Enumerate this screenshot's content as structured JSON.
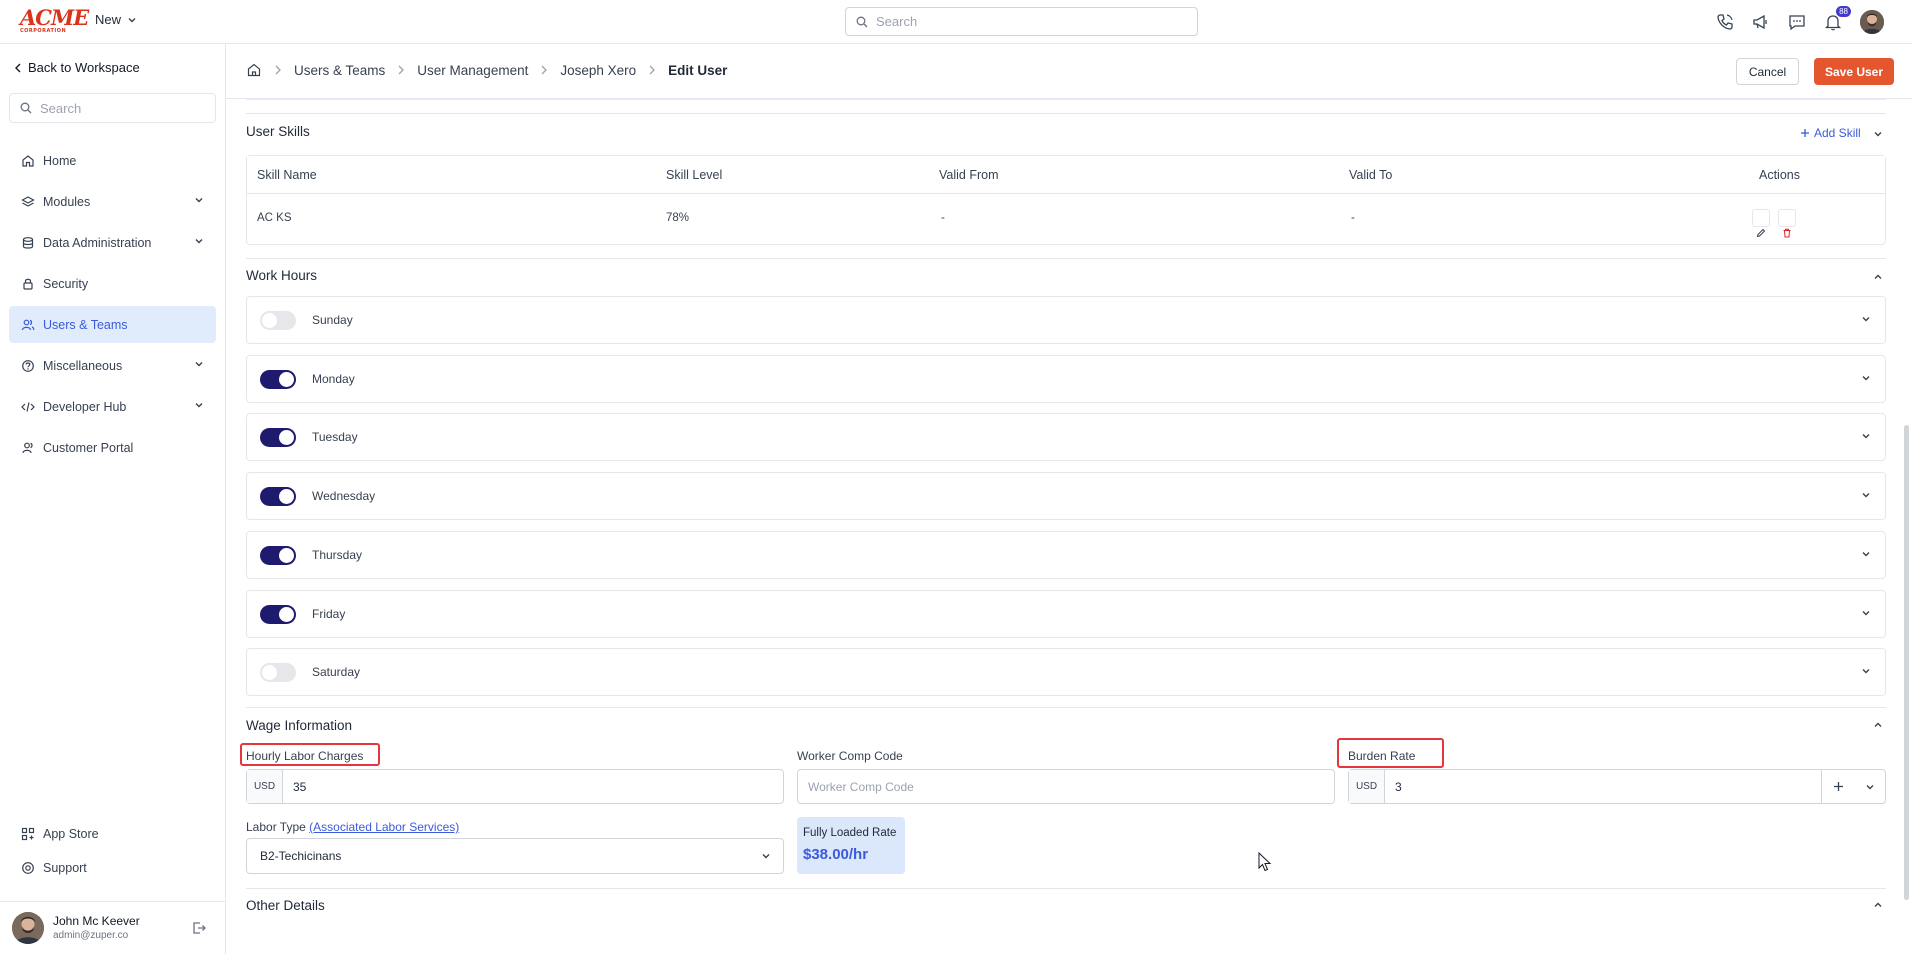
{
  "topbar": {
    "logo_main": "ACME",
    "logo_sub": "CORPORATION",
    "new_label": "New",
    "search_placeholder": "Search",
    "notification_count": "88"
  },
  "sidebar": {
    "back_label": "Back to Workspace",
    "search_placeholder": "Search",
    "items": [
      {
        "label": "Home",
        "icon": "home-icon"
      },
      {
        "label": "Modules",
        "icon": "layers-icon",
        "expandable": true
      },
      {
        "label": "Data Administration",
        "icon": "database-icon",
        "expandable": true
      },
      {
        "label": "Security",
        "icon": "lock-icon"
      },
      {
        "label": "Users & Teams",
        "icon": "users-icon",
        "active": true
      },
      {
        "label": "Miscellaneous",
        "icon": "help-circle-icon",
        "expandable": true
      },
      {
        "label": "Developer Hub",
        "icon": "code-icon",
        "expandable": true
      },
      {
        "label": "Customer Portal",
        "icon": "user-icon"
      }
    ],
    "bottom_items": [
      {
        "label": "App Store",
        "icon": "grid-icon"
      },
      {
        "label": "Support",
        "icon": "support-icon"
      }
    ],
    "user": {
      "name": "John Mc Keever",
      "email": "admin@zuper.co"
    }
  },
  "header": {
    "breadcrumbs": [
      "Users & Teams",
      "User Management",
      "Joseph Xero",
      "Edit User"
    ],
    "cancel_label": "Cancel",
    "save_label": "Save User"
  },
  "skills": {
    "title": "User Skills",
    "add_label": "Add Skill",
    "columns": [
      "Skill Name",
      "Skill Level",
      "Valid From",
      "Valid To",
      "Actions"
    ],
    "rows": [
      {
        "name": "AC KS",
        "level": "78%",
        "valid_from": "-",
        "valid_to": "-"
      }
    ]
  },
  "work_hours": {
    "title": "Work Hours",
    "days": [
      {
        "label": "Sunday",
        "enabled": false
      },
      {
        "label": "Monday",
        "enabled": true
      },
      {
        "label": "Tuesday",
        "enabled": true
      },
      {
        "label": "Wednesday",
        "enabled": true
      },
      {
        "label": "Thursday",
        "enabled": true
      },
      {
        "label": "Friday",
        "enabled": true
      },
      {
        "label": "Saturday",
        "enabled": false
      }
    ]
  },
  "wage": {
    "title": "Wage Information",
    "hourly_label": "Hourly Labor Charges",
    "hourly_currency": "USD",
    "hourly_value": "35",
    "comp_label": "Worker Comp Code",
    "comp_placeholder": "Worker Comp Code",
    "burden_label": "Burden Rate",
    "burden_currency": "USD",
    "burden_value": "3",
    "labor_type_label": "Labor Type",
    "labor_type_link": "(Associated Labor Services)",
    "labor_type_value": "B2-Techicinans",
    "fully_loaded_label": "Fully Loaded Rate",
    "fully_loaded_value": "$38.00/hr"
  },
  "other": {
    "title": "Other Details"
  },
  "colors": {
    "accent": "#3b5bdb",
    "save": "#e4572e",
    "toggle_on": "#1e1b6e",
    "highlight": "#e5363d"
  }
}
